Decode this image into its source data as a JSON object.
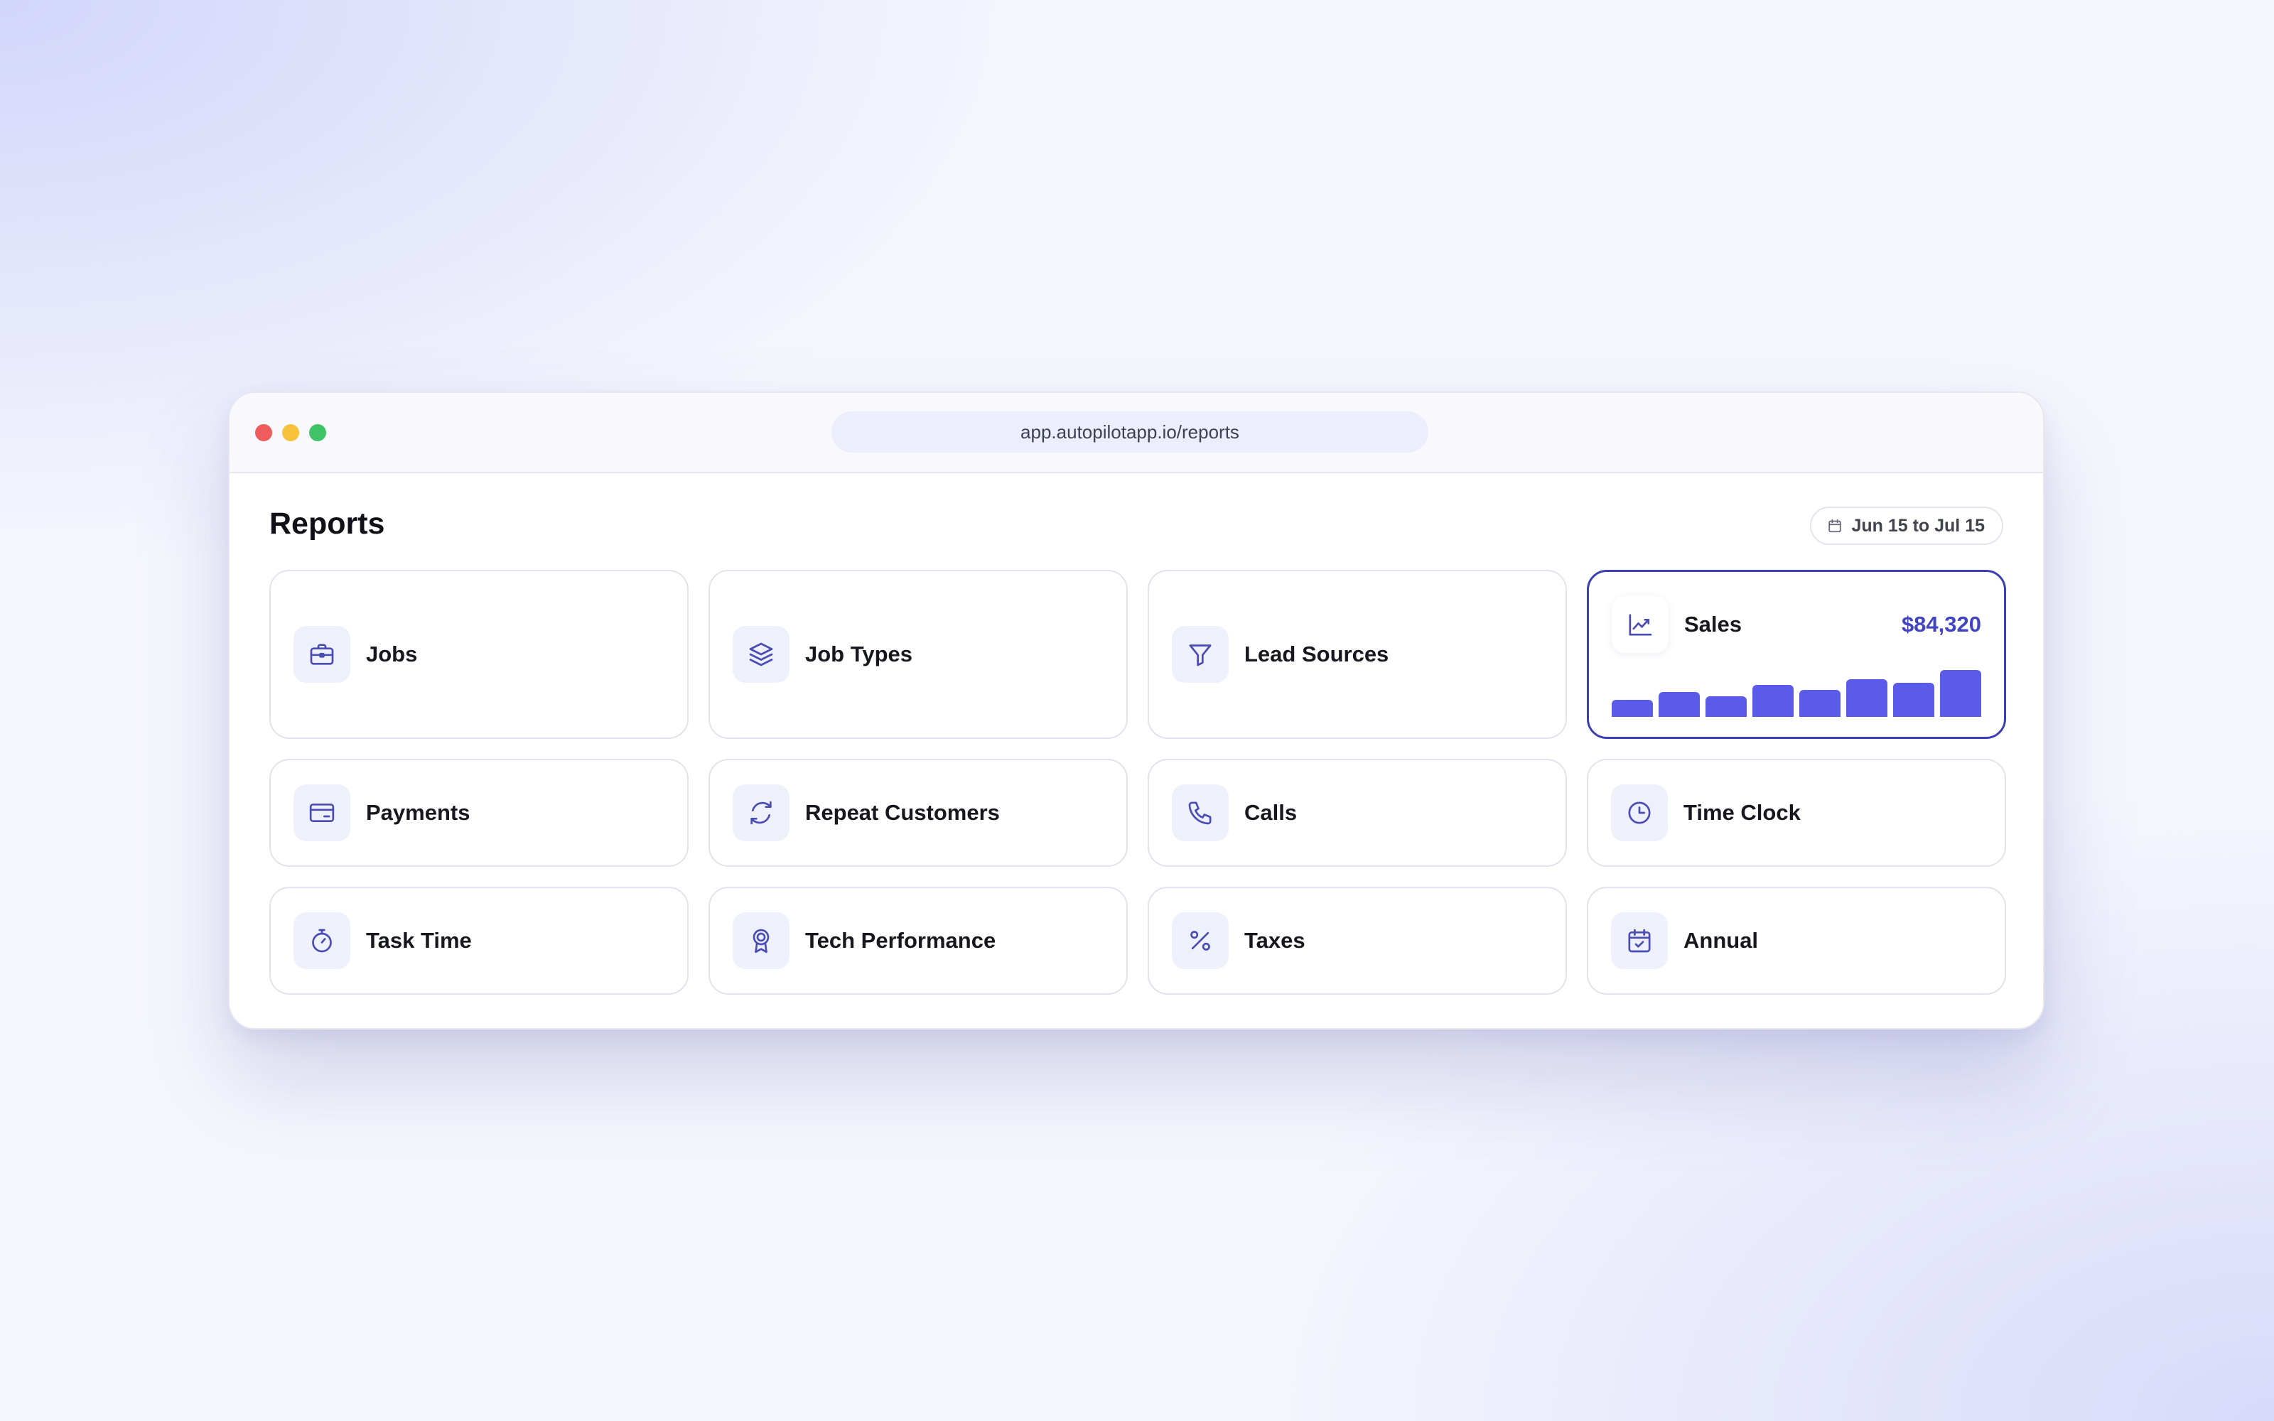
{
  "browser": {
    "url": "app.autopilotapp.io/reports"
  },
  "page": {
    "title": "Reports",
    "date_range": "Jun 15 to Jul 15"
  },
  "cards": [
    {
      "label": "Jobs",
      "icon": "briefcase-icon"
    },
    {
      "label": "Job Types",
      "icon": "layers-icon"
    },
    {
      "label": "Lead Sources",
      "icon": "filter-icon"
    },
    {
      "label": "Sales",
      "icon": "trending-chart-icon",
      "value": "$84,320"
    },
    {
      "label": "Payments",
      "icon": "credit-card-icon"
    },
    {
      "label": "Repeat Customers",
      "icon": "refresh-icon"
    },
    {
      "label": "Calls",
      "icon": "phone-icon"
    },
    {
      "label": "Time Clock",
      "icon": "clock-icon"
    },
    {
      "label": "Task Time",
      "icon": "stopwatch-icon"
    },
    {
      "label": "Tech Performance",
      "icon": "award-icon"
    },
    {
      "label": "Taxes",
      "icon": "percent-icon"
    },
    {
      "label": "Annual",
      "icon": "calendar-check-icon"
    }
  ],
  "colors": {
    "accent": "#4145c4",
    "bar": "#5b5bea",
    "icon": "#4a4cb5",
    "icon_bg": "#eef0fb"
  },
  "chart_data": {
    "type": "bar",
    "values": [
      23,
      33,
      27,
      42,
      36,
      50,
      45,
      62
    ],
    "ylim": [
      0,
      64
    ],
    "title": "",
    "xlabel": "",
    "ylabel": ""
  }
}
